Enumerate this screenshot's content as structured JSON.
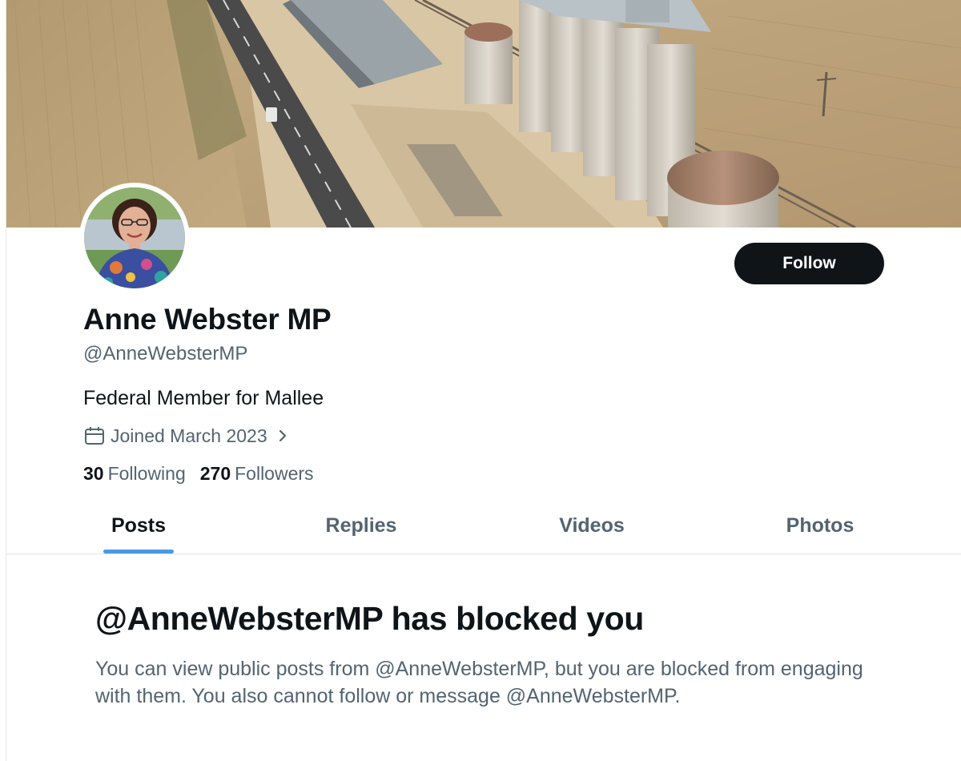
{
  "profile": {
    "display_name": "Anne Webster MP",
    "handle": "@AnneWebsterMP",
    "bio": "Federal Member for Mallee",
    "joined": "Joined March 2023",
    "following_count": "30",
    "following_label": "Following",
    "followers_count": "270",
    "followers_label": "Followers"
  },
  "actions": {
    "follow_label": "Follow"
  },
  "tabs": [
    {
      "label": "Posts",
      "active": true
    },
    {
      "label": "Replies",
      "active": false
    },
    {
      "label": "Videos",
      "active": false
    },
    {
      "label": "Photos",
      "active": false
    }
  ],
  "blocked": {
    "title": "@AnneWebsterMP has blocked you",
    "message": "You can view public posts from @AnneWebsterMP, but you are blocked from engaging with them. You also cannot follow or message @AnneWebsterMP."
  },
  "icons": {
    "joined": "calendar-icon",
    "joined_more": "chevron-right-icon"
  },
  "colors": {
    "text_primary": "#0f1419",
    "text_secondary": "#536471",
    "accent": "#4a99e9",
    "button_bg": "#0f1419"
  }
}
